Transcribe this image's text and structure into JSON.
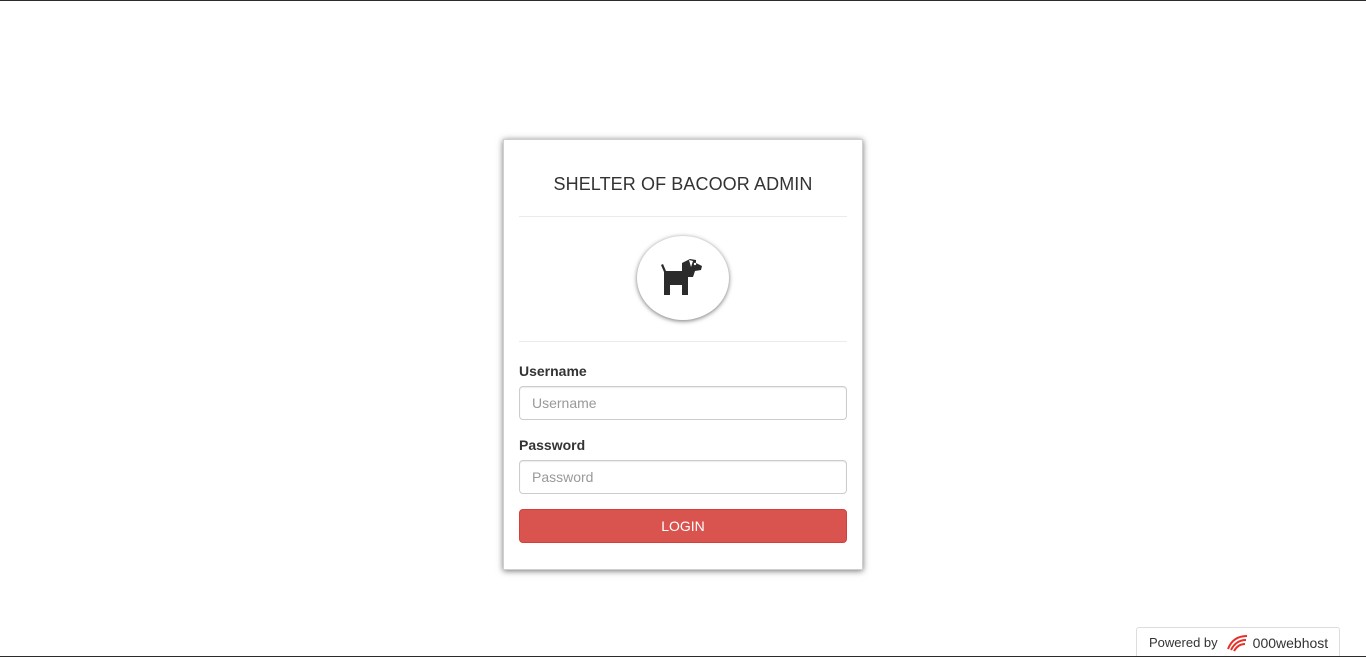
{
  "login": {
    "title": "SHELTER OF BACOOR ADMIN",
    "logo_icon": "dog-icon",
    "username_label": "Username",
    "username_placeholder": "Username",
    "username_value": "",
    "password_label": "Password",
    "password_placeholder": "Password",
    "password_value": "",
    "button_label": "LOGIN",
    "button_color": "#d9534f"
  },
  "footer": {
    "powered_by": "Powered by",
    "brand": "000webhost",
    "brand_icon": "000webhost-logo-icon",
    "brand_color": "#e5312b"
  }
}
